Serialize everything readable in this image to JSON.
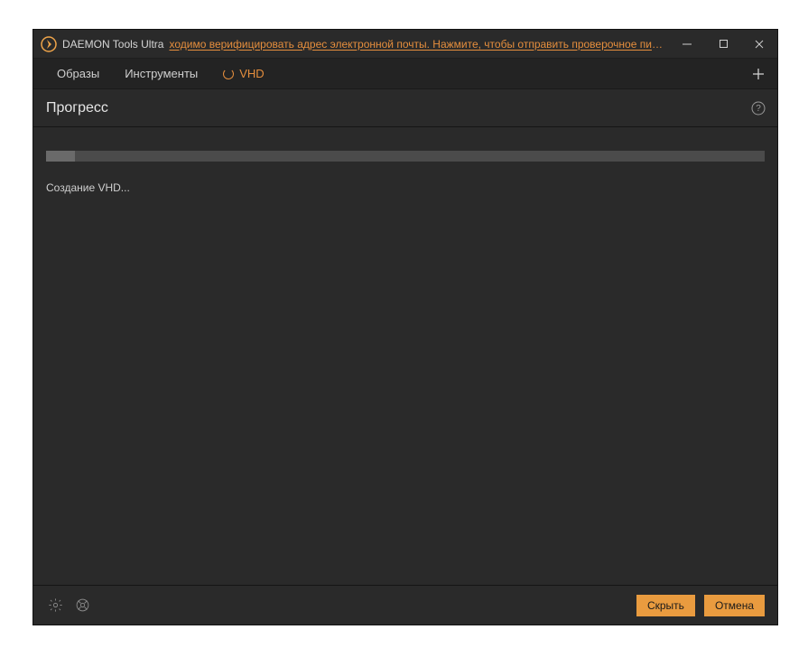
{
  "titlebar": {
    "app_title": "DAEMON Tools Ultra",
    "notice": "ходимо верифицировать адрес электронной почты. Нажмите, чтобы отправить проверочное письмо снова"
  },
  "tabs": [
    {
      "label": "Образы",
      "active": false
    },
    {
      "label": "Инструменты",
      "active": false
    },
    {
      "label": "VHD",
      "active": true
    }
  ],
  "page": {
    "title": "Прогресс",
    "status": "Создание VHD...",
    "progress_percent": 4
  },
  "footer": {
    "hide_label": "Скрыть",
    "cancel_label": "Отмена"
  },
  "colors": {
    "accent": "#e58e3d",
    "button": "#e99b3f",
    "bg": "#2a2a2a",
    "track": "#4b4b4b"
  }
}
